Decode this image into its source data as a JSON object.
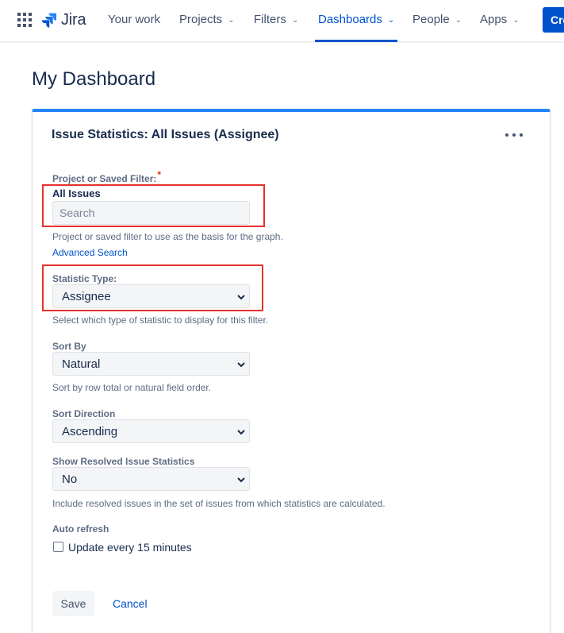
{
  "nav": {
    "logo_text": "Jira",
    "items": [
      {
        "label": "Your work",
        "dropdown": false,
        "active": false
      },
      {
        "label": "Projects",
        "dropdown": true,
        "active": false
      },
      {
        "label": "Filters",
        "dropdown": true,
        "active": false
      },
      {
        "label": "Dashboards",
        "dropdown": true,
        "active": true
      },
      {
        "label": "People",
        "dropdown": true,
        "active": false
      },
      {
        "label": "Apps",
        "dropdown": true,
        "active": false
      }
    ],
    "create_label": "Create",
    "icons": {
      "apps": "app-grid-icon",
      "logo": "jira-logo-icon",
      "dropdown": "chevron-down-icon"
    }
  },
  "page": {
    "title": "My Dashboard"
  },
  "gadget": {
    "title": "Issue Statistics: All Issues (Assignee)",
    "more_icon": "more-horizontal-icon",
    "accent_color": "#2684ff",
    "filter": {
      "label": "Project or Saved Filter:",
      "required_mark": "*",
      "selected": "All Issues",
      "search_placeholder": "Search",
      "help": "Project or saved filter to use as the basis for the graph.",
      "advanced_link": "Advanced Search"
    },
    "statistic_type": {
      "label": "Statistic Type:",
      "value": "Assignee",
      "help": "Select which type of statistic to display for this filter."
    },
    "sort_by": {
      "label": "Sort By",
      "value": "Natural",
      "help": "Sort by row total or natural field order."
    },
    "sort_direction": {
      "label": "Sort Direction",
      "value": "Ascending"
    },
    "show_resolved": {
      "label": "Show Resolved Issue Statistics",
      "value": "No",
      "help": "Include resolved issues in the set of issues from which statistics are calculated."
    },
    "auto_refresh": {
      "label": "Auto refresh",
      "checkbox_label": "Update every 15 minutes",
      "checked": false
    },
    "actions": {
      "save": "Save",
      "cancel": "Cancel"
    }
  },
  "annotations": {
    "highlight_color": "#e5322d"
  }
}
